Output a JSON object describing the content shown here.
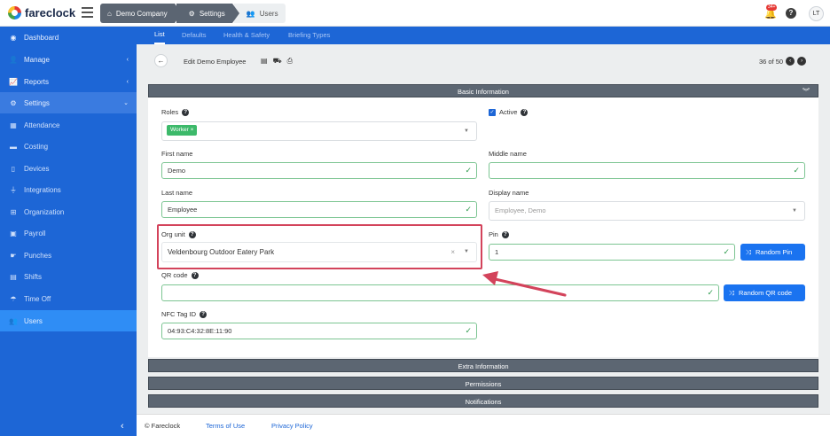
{
  "app": {
    "logo_text": "fareclock"
  },
  "breadcrumbs": [
    {
      "label": "Demo Company",
      "icon": "home-icon"
    },
    {
      "label": "Settings",
      "icon": "gear-icon"
    },
    {
      "label": "Users",
      "icon": "users-icon"
    }
  ],
  "header": {
    "notification_count": "34+",
    "help": "?",
    "avatar_initials": "LT"
  },
  "sidebar": {
    "items": [
      {
        "label": "Dashboard",
        "icon": "dashboard-icon"
      },
      {
        "label": "Manage",
        "icon": "person-icon"
      },
      {
        "label": "Reports",
        "icon": "chart-icon"
      },
      {
        "label": "Settings",
        "icon": "gear-icon"
      },
      {
        "label": "Attendance",
        "icon": "attendance-icon"
      },
      {
        "label": "Costing",
        "icon": "costing-icon"
      },
      {
        "label": "Devices",
        "icon": "device-icon"
      },
      {
        "label": "Integrations",
        "icon": "plug-icon"
      },
      {
        "label": "Organization",
        "icon": "org-icon"
      },
      {
        "label": "Payroll",
        "icon": "payroll-icon"
      },
      {
        "label": "Punches",
        "icon": "punches-icon"
      },
      {
        "label": "Shifts",
        "icon": "shifts-icon"
      },
      {
        "label": "Time Off",
        "icon": "timeoff-icon"
      },
      {
        "label": "Users",
        "icon": "users-icon"
      }
    ]
  },
  "tabs": [
    "List",
    "Defaults",
    "Health & Safety",
    "Briefing Types"
  ],
  "edit": {
    "title": "Edit Demo Employee",
    "pager": "36 of 50"
  },
  "sections": {
    "basic": "Basic Information",
    "extra": "Extra Information",
    "permissions": "Permissions",
    "notifications": "Notifications"
  },
  "form": {
    "roles_label": "Roles",
    "roles_tag": "Worker",
    "active_label": "Active",
    "first_name_label": "First name",
    "first_name": "Demo",
    "middle_name_label": "Middle name",
    "middle_name": "",
    "last_name_label": "Last name",
    "last_name": "Employee",
    "display_name_label": "Display name",
    "display_name_placeholder": "Employee, Demo",
    "org_unit_label": "Org unit",
    "org_unit": "Veldenbourg Outdoor Eatery Park",
    "pin_label": "Pin",
    "pin": "1",
    "random_pin": "Random Pin",
    "qr_label": "QR code",
    "qr": "",
    "random_qr": "Random QR code",
    "nfc_label": "NFC Tag ID",
    "nfc": "04:93:C4:32:8E:11:90"
  },
  "footer": {
    "copyright": "© Fareclock",
    "terms": "Terms of Use",
    "privacy": "Privacy Policy"
  },
  "colors": {
    "accent": "#1d66d6",
    "highlight": "#d3435b",
    "section_bar": "#5c6672",
    "tag_green": "#3cb96a"
  }
}
